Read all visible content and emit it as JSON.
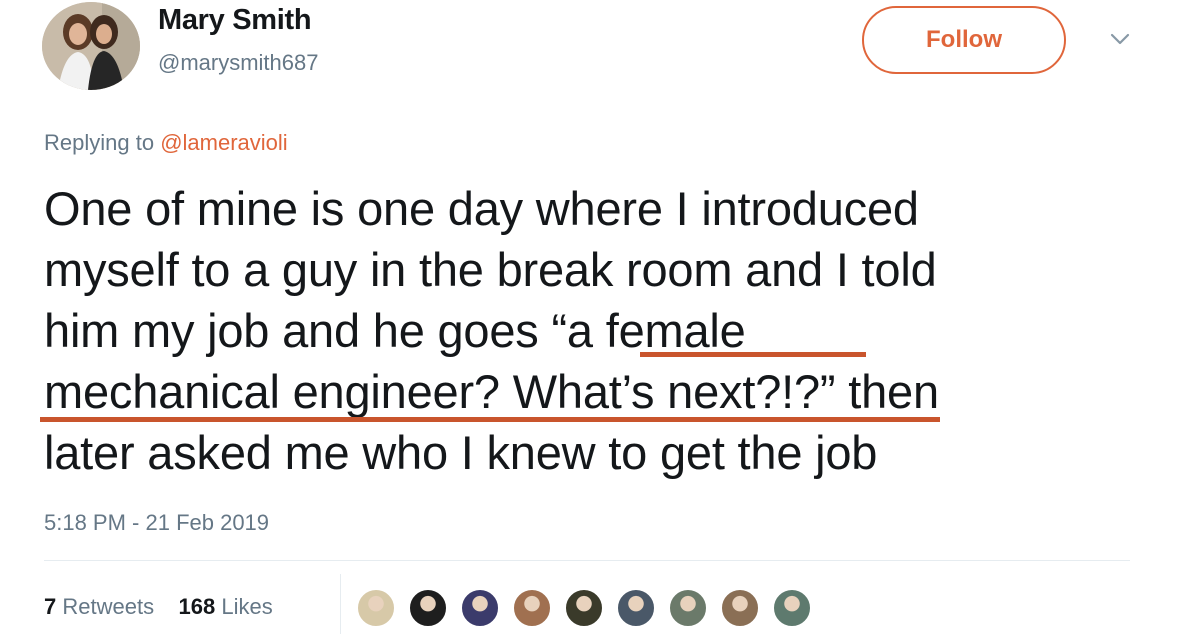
{
  "user": {
    "name": "Mary Smith",
    "handle": "@marysmith687"
  },
  "follow_label": "Follow",
  "reply": {
    "prefix": "Replying to ",
    "mention": "@lameravioli"
  },
  "tweet": {
    "line1": "One of mine is one day where I introduced",
    "line2": "myself to a guy in the break room and I told",
    "line3": "him my job and he goes “a female",
    "line4": "mechanical engineer? What’s next?!?” then",
    "line5": "later asked me who I knew to get the job"
  },
  "timestamp": "5:18 PM - 21 Feb 2019",
  "stats": {
    "retweets_count": "7",
    "retweets_label": "Retweets",
    "likes_count": "168",
    "likes_label": "Likes"
  },
  "colors": {
    "accent": "#e0663b",
    "highlight_underline": "#c9552d",
    "secondary_text": "#657786"
  },
  "likers": [
    {
      "color": "#d7c9a8"
    },
    {
      "color": "#1e1e1e"
    },
    {
      "color": "#3b3b6b"
    },
    {
      "color": "#a07050"
    },
    {
      "color": "#3a3a2a"
    },
    {
      "color": "#4a5868"
    },
    {
      "color": "#6b7a6a"
    },
    {
      "color": "#8a6f55"
    },
    {
      "color": "#5e7a6e"
    }
  ]
}
